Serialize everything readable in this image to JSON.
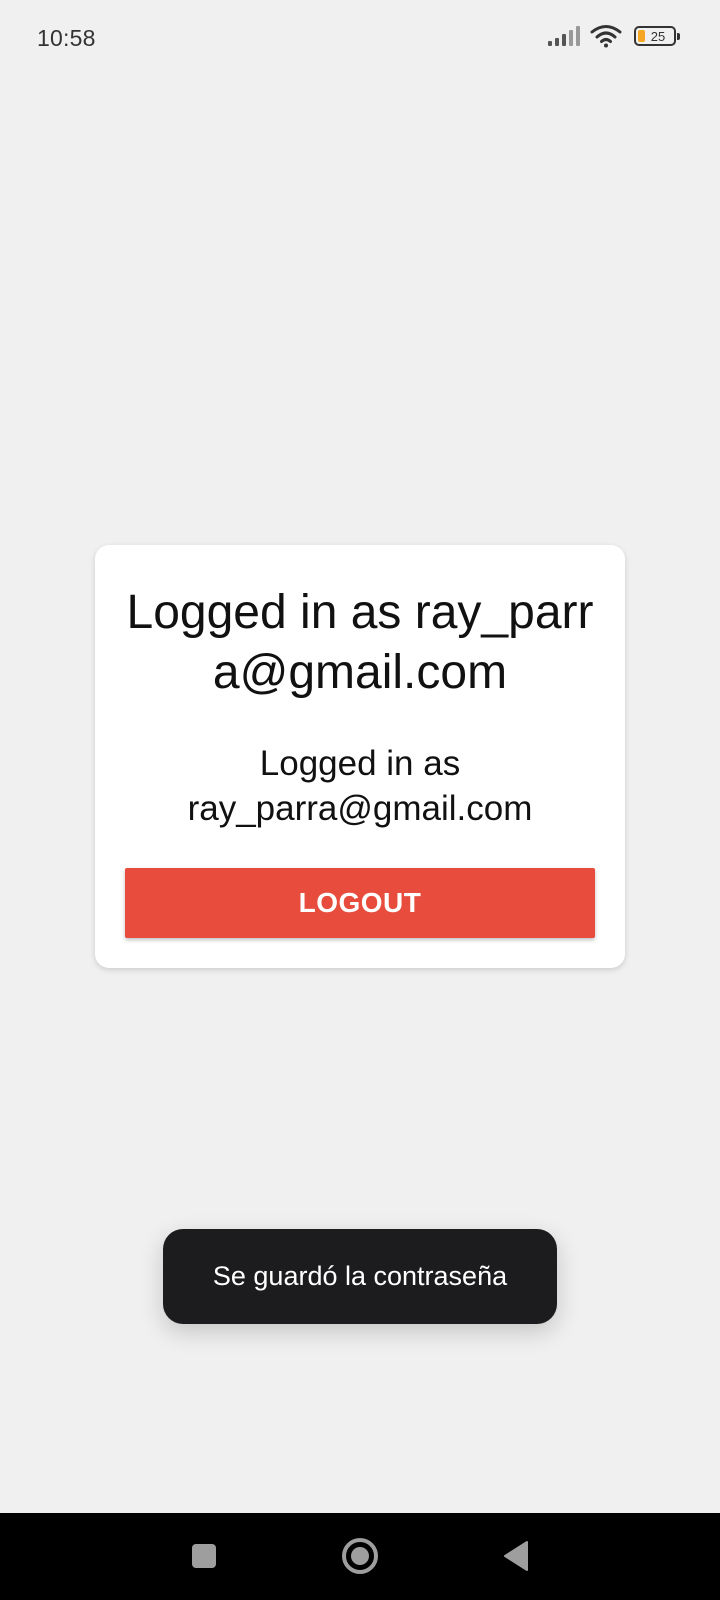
{
  "status_bar": {
    "time": "10:58",
    "battery_level": "25",
    "icons": [
      "signal-icon",
      "wifi-icon",
      "battery-icon"
    ],
    "battery_color": "#f5a623"
  },
  "card": {
    "title": "Logged in as ray_parra@gmail.com",
    "subtitle": "Logged in as ray_parra@gmail.com",
    "logout_label": "LOGOUT",
    "button_color": "#e74c3c"
  },
  "toast": {
    "message": "Se guardó la contraseña"
  },
  "nav_bar": {
    "icons": [
      "recent-apps-icon",
      "home-icon",
      "back-icon"
    ]
  }
}
